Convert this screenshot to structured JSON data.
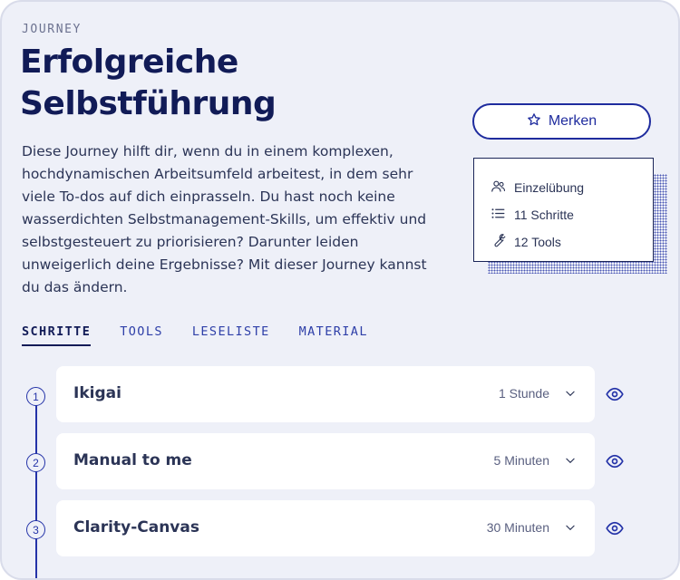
{
  "header": {
    "eyebrow": "JOURNEY",
    "title": "Erfolgreiche Selbstführung",
    "description": "Diese Journey hilft dir, wenn du in einem komplexen, hochdynamischen Arbeitsumfeld arbeitest, in dem sehr viele To-dos auf dich einprasseln. Du hast noch keine wasserdichten Selbstmanagement-Skills, um effektiv und selbstgesteuert zu priorisieren? Darunter leiden unweigerlich deine Ergebnisse? Mit dieser Journey kannst du das ändern."
  },
  "actions": {
    "merken_label": "Merken",
    "merken_icon": "star-icon"
  },
  "meta": {
    "items": [
      {
        "icon": "users-icon",
        "label": "Einzelübung"
      },
      {
        "icon": "list-icon",
        "label": "11 Schritte"
      },
      {
        "icon": "wrench-icon",
        "label": "12 Tools"
      }
    ]
  },
  "tabs": [
    {
      "label": "SCHRITTE",
      "active": true
    },
    {
      "label": "TOOLS",
      "active": false
    },
    {
      "label": "LESELISTE",
      "active": false
    },
    {
      "label": "MATERIAL",
      "active": false
    }
  ],
  "steps": [
    {
      "number": "1",
      "title": "Ikigai",
      "duration": "1 Stunde"
    },
    {
      "number": "2",
      "title": "Manual to me",
      "duration": "5 Minuten"
    },
    {
      "number": "3",
      "title": "Clarity-Canvas",
      "duration": "30 Minuten"
    }
  ],
  "colors": {
    "accent": "#1f2c9e",
    "heading": "#111b57",
    "background": "#eef0f8"
  }
}
